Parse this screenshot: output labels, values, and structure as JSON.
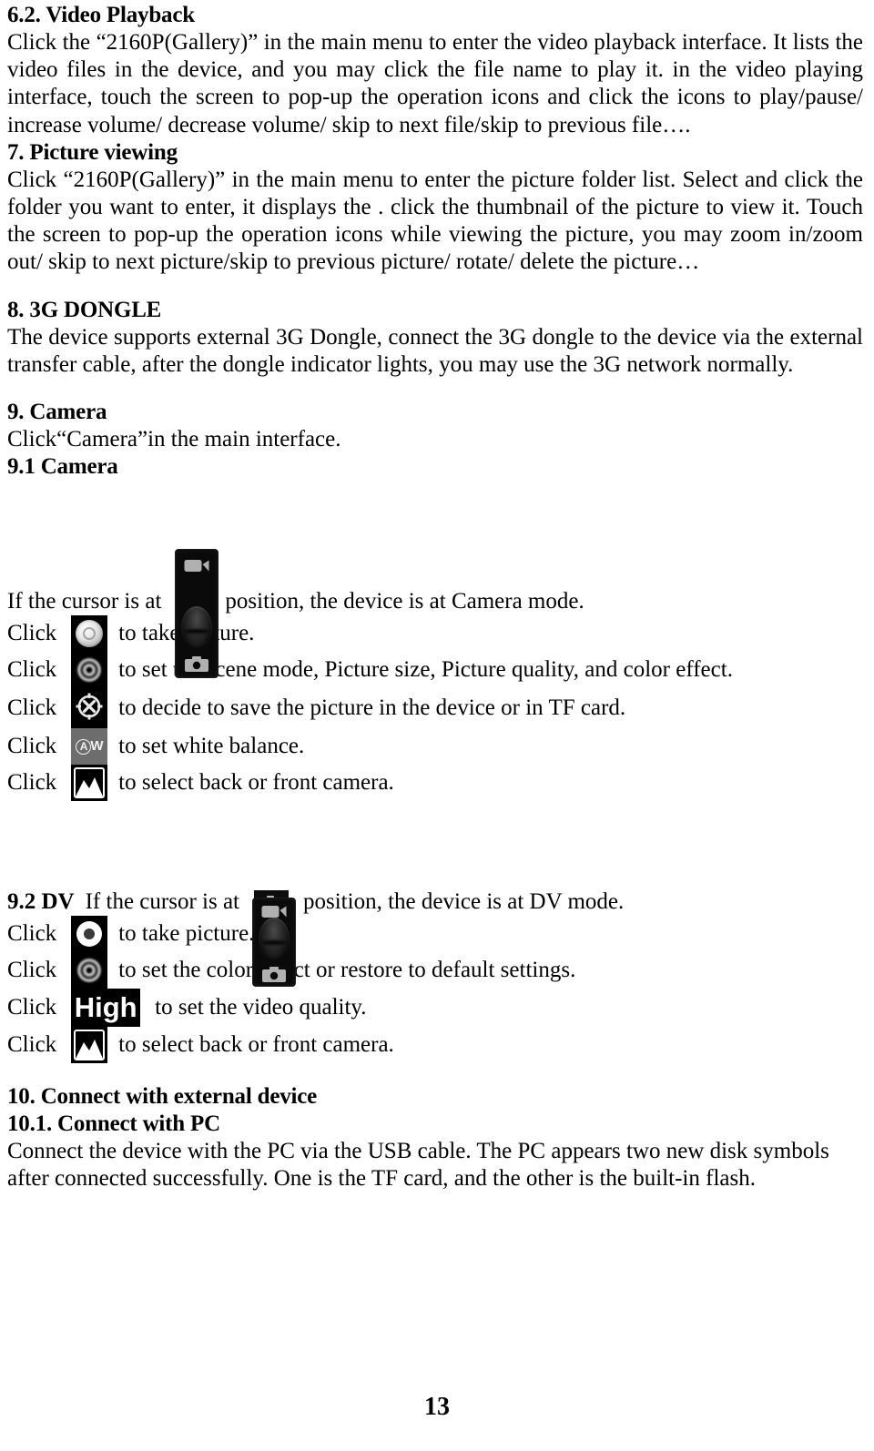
{
  "document": {
    "page_number": "13",
    "sections": [
      {
        "id": "video-playback",
        "heading": "6.2. Video Playback",
        "paragraph": "Click the “2160P(Gallery)” in the main menu to enter the video playback interface. It lists the video files in the device, and you may click the file name to play it. in the video playing interface, touch the screen to pop-up the operation icons and click the icons to play/pause/ increase volume/ decrease volume/ skip to next file/skip to previous file…."
      },
      {
        "id": "picture-viewing",
        "heading": "7. Picture viewing",
        "paragraph": "Click “2160P(Gallery)” in the main menu to enter the picture folder list. Select and click the folder you want to enter, it displays the . click the thumbnail of the picture to view it. Touch the screen to pop-up the operation icons while viewing the picture, you may zoom in/zoom out/ skip to next picture/skip to previous picture/ rotate/ delete the picture…"
      },
      {
        "id": "3g-dongle",
        "heading": "8. 3G DONGLE",
        "paragraph": "The device supports external 3G Dongle, connect the 3G dongle to the device via the external transfer cable, after the dongle indicator lights, you may use the 3G network normally."
      },
      {
        "id": "camera",
        "heading": "9. Camera",
        "paragraph": "Click“Camera”in the main interface."
      }
    ],
    "camera_subsection": {
      "heading": "9.1 Camera",
      "cursor_sentence_before": "If the cursor is at",
      "cursor_sentence_after": "position, the device is at Camera mode.",
      "mode_widget": {
        "top_icon": "video-camera-icon",
        "bottom_icon": "photo-camera-icon",
        "knob_position": "bottom"
      },
      "icon_rows": [
        {
          "click_label": "Click",
          "icon": "shutter-icon",
          "description": "to take picture."
        },
        {
          "click_label": "Click",
          "icon": "settings-ring-icon",
          "description": "to set the scene mode, Picture size, Picture quality, and color effect."
        },
        {
          "click_label": "Click",
          "icon": "storage-crosshair-icon",
          "description": "to decide to save the picture in the device or in TF card."
        },
        {
          "click_label": "Click",
          "icon": "auto-white-balance-icon",
          "description": "to set white balance."
        },
        {
          "click_label": "Click",
          "icon": "landscape-icon",
          "description": "to select back or front camera."
        }
      ]
    },
    "dv_subsection": {
      "heading": "9.2 DV",
      "cursor_sentence_before": "If the cursor is at",
      "cursor_sentence_after": "position, the device is at DV mode.",
      "mode_widget": {
        "top_icon": "video-camera-icon",
        "bottom_icon": "photo-camera-icon",
        "knob_position": "top"
      },
      "icon_rows": [
        {
          "click_label": "Click",
          "icon": "record-icon",
          "description": "to take picture."
        },
        {
          "click_label": "Click",
          "icon": "color-effect-ring-icon",
          "description": "to set the color effect or restore to default settings."
        },
        {
          "click_label": "Click",
          "icon": "high-quality-badge",
          "icon_text": "High",
          "description": "to set the video quality."
        },
        {
          "click_label": "Click",
          "icon": "landscape-icon",
          "description": "to select back or front camera."
        }
      ]
    },
    "connect_section": {
      "heading": "10. Connect with external device",
      "subheading": "10.1. Connect with PC",
      "paragraph": "Connect the device with the PC via the USB cable. The PC appears two new disk symbols after connected successfully. One is the TF card, and the other is the built-in flash."
    },
    "colors": {
      "text": "#000000",
      "background": "#ffffff",
      "icon_tile": "#000000",
      "icon_tile_gray": "#6d6d6d",
      "icon_foreground": "#ffffff"
    }
  }
}
